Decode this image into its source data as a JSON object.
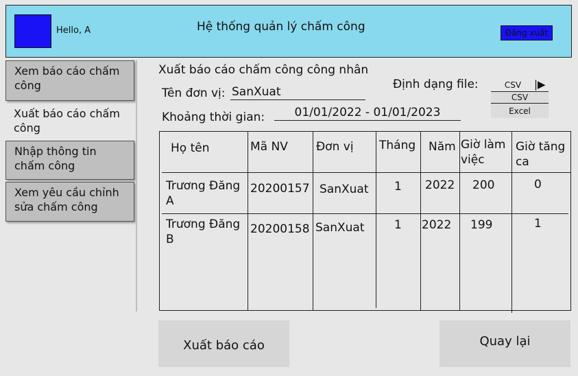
{
  "header": {
    "greeting": "Hello, A",
    "title": "Hệ thống quản lý chấm công",
    "logout_label": "Đăng xuất",
    "colors": {
      "header_bg": "#89d9ee",
      "avatar": "#1a12f5",
      "logout_bg": "#1a12f5"
    }
  },
  "sidebar": {
    "items": [
      {
        "label": "Xem báo cáo chấm công"
      },
      {
        "label": "Xuất báo cáo chấm công"
      },
      {
        "label": "Nhập thông tin chấm công"
      },
      {
        "label": "Xem yêu cầu chỉnh sửa chấm công"
      }
    ]
  },
  "main": {
    "title": "Xuất báo cáo chấm công công nhân",
    "unit_label": "Tên đơn vị:",
    "unit_value": "SanXuat",
    "period_label": "Khoảng thời gian:",
    "period_value": "01/01/2022 - 01/01/2023",
    "format_label": "Định dạng file:",
    "format_selected": "CSV",
    "format_options": [
      "CSV",
      "Excel"
    ],
    "table": {
      "headers": [
        "Họ tên",
        "Mã NV",
        "Đơn vị",
        "Tháng",
        "Năm",
        "Giờ làm việc",
        "Giờ tăng ca"
      ],
      "rows": [
        [
          "Trương Đăng A",
          "20200157",
          "SanXuat",
          "1",
          "2022",
          "200",
          "0"
        ],
        [
          "Trương Đăng B",
          "20200158",
          "SanXuat",
          "1",
          "2022",
          "199",
          "1"
        ]
      ]
    },
    "export_label": "Xuất báo cáo",
    "back_label": "Quay lại"
  }
}
